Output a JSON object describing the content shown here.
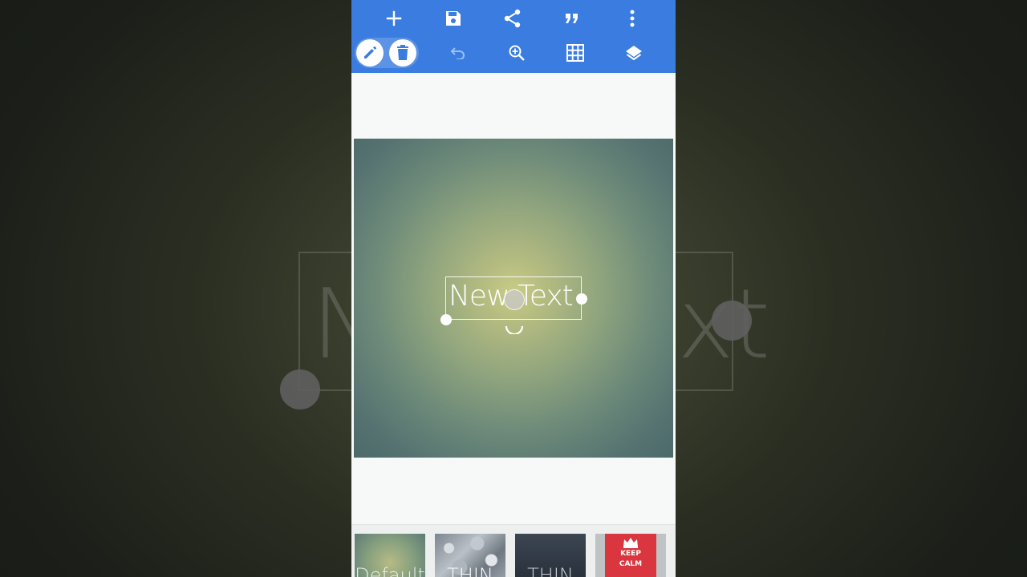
{
  "toolbar": {
    "row1": [
      {
        "name": "add",
        "icon": "plus-icon"
      },
      {
        "name": "save",
        "icon": "floppy-disk-icon"
      },
      {
        "name": "share",
        "icon": "share-icon"
      },
      {
        "name": "quote",
        "icon": "quote-icon"
      },
      {
        "name": "more",
        "icon": "more-vertical-icon"
      }
    ],
    "row2": [
      {
        "name": "edit",
        "icon": "pencil-icon",
        "active": true
      },
      {
        "name": "delete",
        "icon": "trash-icon",
        "active": true
      },
      {
        "name": "undo",
        "icon": "undo-icon",
        "disabled": true
      },
      {
        "name": "zoom",
        "icon": "zoom-in-icon"
      },
      {
        "name": "grid",
        "icon": "grid-icon"
      },
      {
        "name": "layers",
        "icon": "layers-icon"
      }
    ],
    "color": "#3a7ce0"
  },
  "canvas": {
    "text": "New Text"
  },
  "backdrop": {
    "left_text": "N",
    "right_text": "xt"
  },
  "templates": [
    {
      "label": "Default"
    },
    {
      "label": "THIN"
    },
    {
      "label": "THIN"
    },
    {
      "label": "KEEP CALM",
      "line1": "KEEP",
      "line2": "CALM",
      "icon": "crown-icon"
    }
  ]
}
